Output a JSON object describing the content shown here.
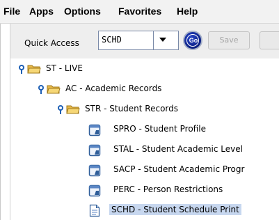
{
  "menubar": {
    "items": [
      "File",
      "Apps",
      "Options",
      "Favorites",
      "Help"
    ]
  },
  "toolbar": {
    "quick_access_label": "Quick Access",
    "quick_access_value": "SCHD",
    "go_label": "Go",
    "save_label": "Save"
  },
  "tree": {
    "nodes": [
      {
        "label": "ST - LIVE",
        "level": 0,
        "type": "folder",
        "expanded": true
      },
      {
        "label": "AC - Academic Records",
        "level": 1,
        "type": "folder",
        "expanded": true
      },
      {
        "label": "STR - Student Records",
        "level": 2,
        "type": "folder",
        "expanded": true
      },
      {
        "label": "SPRO - Student Profile",
        "level": 3,
        "type": "form-window"
      },
      {
        "label": "STAL - Student Academic Level",
        "level": 3,
        "type": "form-window"
      },
      {
        "label": "SACP - Student Academic Progr",
        "level": 3,
        "type": "form-window"
      },
      {
        "label": "PERC - Person Restrictions",
        "level": 3,
        "type": "form-window"
      },
      {
        "label": "SCHD - Student Schedule Print",
        "level": 3,
        "type": "document",
        "selected": true
      }
    ]
  },
  "colors": {
    "selection": "#c7d7ef",
    "go_button": "#0a1f82",
    "folder": "#f2c94c"
  }
}
